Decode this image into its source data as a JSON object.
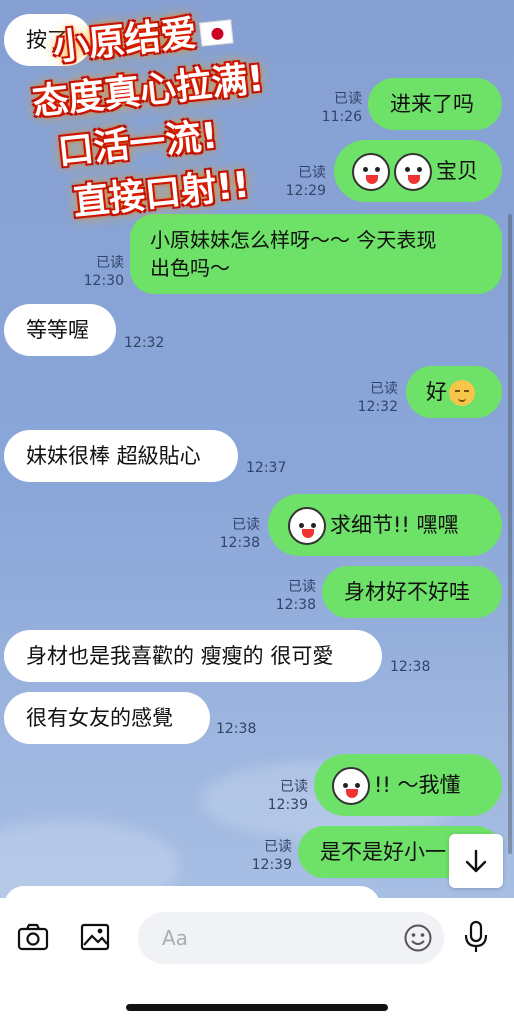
{
  "overlay": {
    "lines": [
      "小原结爱",
      "态度真心拉满!",
      "口活一流!",
      "直接口射!!"
    ]
  },
  "messages": [
    {
      "side": "in",
      "text": "按了"
    },
    {
      "side": "out",
      "text": "进来了吗",
      "read": "已读",
      "time": "11:26"
    },
    {
      "side": "out",
      "text": "宝贝",
      "read": "已读",
      "time": "12:29",
      "stickers": [
        "sticker",
        "sticker"
      ]
    },
    {
      "side": "out",
      "text_line1": "小原妹妹怎么样呀～～ 今天表现",
      "text_line2": "出色吗～",
      "read": "已读",
      "time": "12:30"
    },
    {
      "side": "in",
      "text": "等等喔",
      "time": "12:32"
    },
    {
      "side": "out",
      "text": "好",
      "read": "已读",
      "time": "12:32",
      "emoji": "relieved-face"
    },
    {
      "side": "in",
      "text": "妹妹很棒 超級貼心",
      "time": "12:37"
    },
    {
      "side": "out",
      "text": "求细节!! 嘿嘿",
      "read": "已读",
      "time": "12:38",
      "sticker": "bunny"
    },
    {
      "side": "out",
      "text": "身材好不好哇",
      "read": "已读",
      "time": "12:38"
    },
    {
      "side": "in",
      "text": "身材也是我喜歡的 瘦瘦的 很可愛",
      "time": "12:38"
    },
    {
      "side": "in",
      "text": "很有女友的感覺",
      "time": "12:38"
    },
    {
      "side": "out",
      "text": "!! ～我懂",
      "read": "已读",
      "time": "12:39",
      "sticker": "bunny"
    },
    {
      "side": "out",
      "text": "是不是好小一",
      "read": "已读",
      "time": "12:39"
    }
  ],
  "composer": {
    "placeholder": "Aa",
    "icons": [
      "camera-icon",
      "image-icon",
      "emoji-icon",
      "microphone-icon"
    ]
  },
  "scroll_button_icon": "arrow-down-icon"
}
